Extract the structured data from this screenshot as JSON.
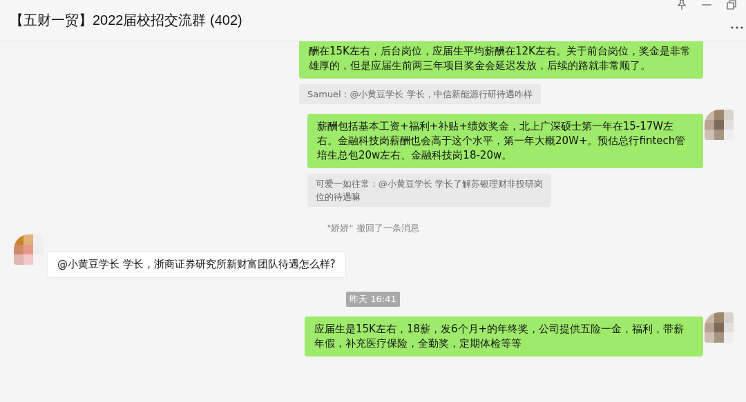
{
  "window": {
    "title": "【五财一贸】2022届校招交流群 (402)"
  },
  "messages": [
    {
      "kind": "sent",
      "avatar": false,
      "text": "酬在15K左右，后台岗位，应届生平均薪酬在12K左右。关于前台岗位，奖金是非常雄厚的，但是应届生前两三年项目奖金会延迟发放，后续的路就非常顺了。"
    },
    {
      "kind": "quote",
      "text": "Samuel : @小黄豆学长 学长，中信新能源行研待遇咋样"
    },
    {
      "kind": "sent",
      "avatar": true,
      "text": "薪酬包括基本工资+福利+补贴+绩效奖金，北上广深硕士第一年在15-17W左右。金融科技岗薪酬也会高于这个水平，第一年大概20W+。预估总行fintech管培生总包20w左右、金融科技岗18-20w。"
    },
    {
      "kind": "quote",
      "text": "可爱一如往常 : @小黄豆学长 学长了解苏银理财非投研岗位的待遇嘛"
    },
    {
      "kind": "system",
      "text": "\"娇娇\" 撤回了一条消息"
    },
    {
      "kind": "received",
      "avatar": true,
      "text": "@小黄豆学长 学长，浙商证券研究所新财富团队待遇怎么样?"
    },
    {
      "kind": "time",
      "text": "昨天 16:41"
    },
    {
      "kind": "sent",
      "avatar": true,
      "text": "应届生是15K左右，18薪，发6个月+的年终奖，公司提供五险一金，福利，带薪年假，补充医疗保险，全勤奖，定期体检等等"
    }
  ]
}
